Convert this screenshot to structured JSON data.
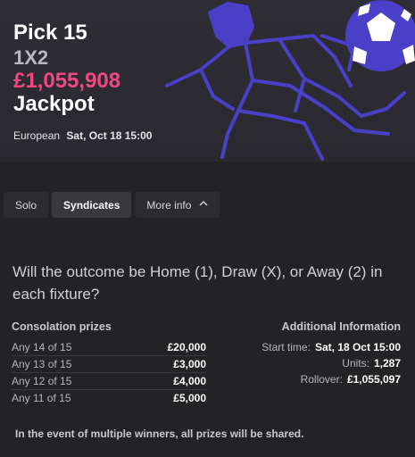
{
  "hero": {
    "title": "Pick 15",
    "subtitle": "1X2",
    "amount": "£1,055,908",
    "jackpot_label": "Jackpot",
    "region": "European",
    "date": "Sat, Oct 18 15:00"
  },
  "tabs": [
    {
      "label": "Solo"
    },
    {
      "label": "Syndicates"
    },
    {
      "label": "More info"
    }
  ],
  "question": "Will the outcome be Home (1), Draw (X), or Away (2) in each fixture?",
  "consolation": {
    "title": "Consolation prizes",
    "rows": [
      {
        "label": "Any 14 of 15",
        "value": "£20,000"
      },
      {
        "label": "Any 13 of 15",
        "value": "£3,000"
      },
      {
        "label": "Any 12 of 15",
        "value": "£4,000"
      },
      {
        "label": "Any 11 of 15",
        "value": "£5,000"
      }
    ]
  },
  "additional": {
    "title": "Additional Information",
    "rows": [
      {
        "key": "Start time:",
        "value": "Sat, 18 Oct 15:00"
      },
      {
        "key": "Units:",
        "value": "1,287"
      },
      {
        "key": "Rollover:",
        "value": "£1,055,097"
      }
    ]
  },
  "footnote": "In the event of multiple winners, all prizes will be shared.",
  "colors": {
    "accent_pink": "#f0497f",
    "art_blue": "#4a3fc7",
    "background": "#232325"
  },
  "icons": {
    "more_info": "chevron-up-icon",
    "hero_art": "football-player-illustration"
  }
}
